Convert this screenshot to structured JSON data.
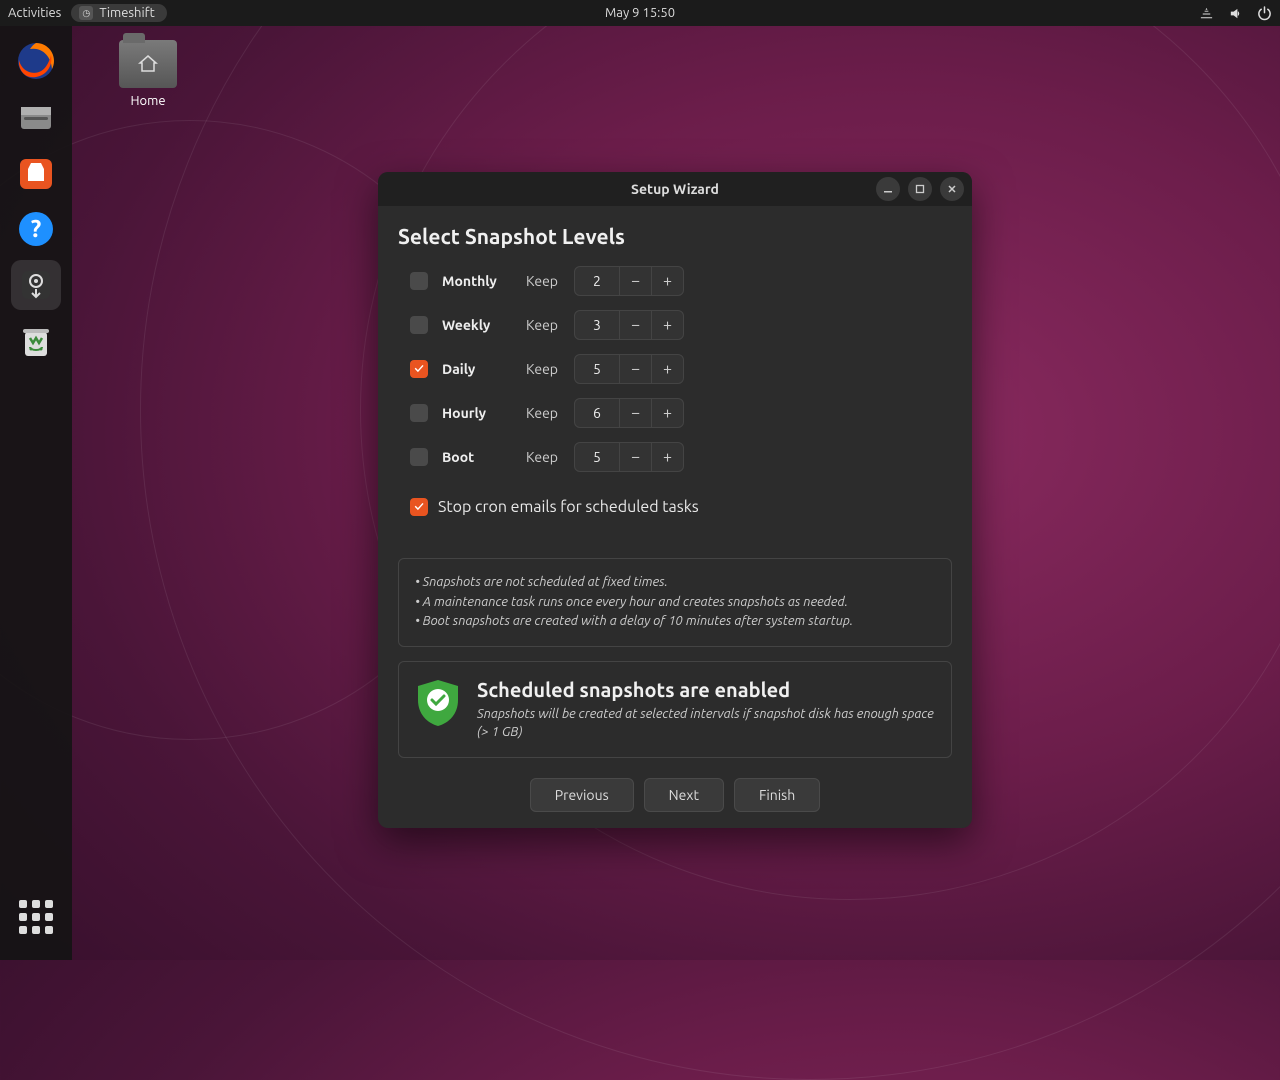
{
  "topbar": {
    "activities": "Activities",
    "app_name": "Timeshift",
    "datetime": "May 9  15:50"
  },
  "desktop": {
    "home_label": "Home"
  },
  "window": {
    "title": "Setup Wizard",
    "heading": "Select Snapshot Levels",
    "keep_label": "Keep",
    "levels": [
      {
        "name": "Monthly",
        "checked": false,
        "value": "2"
      },
      {
        "name": "Weekly",
        "checked": false,
        "value": "3"
      },
      {
        "name": "Daily",
        "checked": true,
        "value": "5"
      },
      {
        "name": "Hourly",
        "checked": false,
        "value": "6"
      },
      {
        "name": "Boot",
        "checked": false,
        "value": "5"
      }
    ],
    "cron_checked": true,
    "cron_label": "Stop cron emails for scheduled tasks",
    "info": {
      "l1": "• Snapshots are not scheduled at fixed times.",
      "l2": "• A maintenance task runs once every hour and creates snapshots as needed.",
      "l3": "• Boot snapshots are created with a delay of 10 minutes after system startup."
    },
    "status": {
      "title": "Scheduled snapshots are enabled",
      "desc": "Snapshots will be created at selected intervals if snapshot disk has enough space (> 1 GB)"
    },
    "buttons": {
      "prev": "Previous",
      "next": "Next",
      "finish": "Finish"
    }
  }
}
